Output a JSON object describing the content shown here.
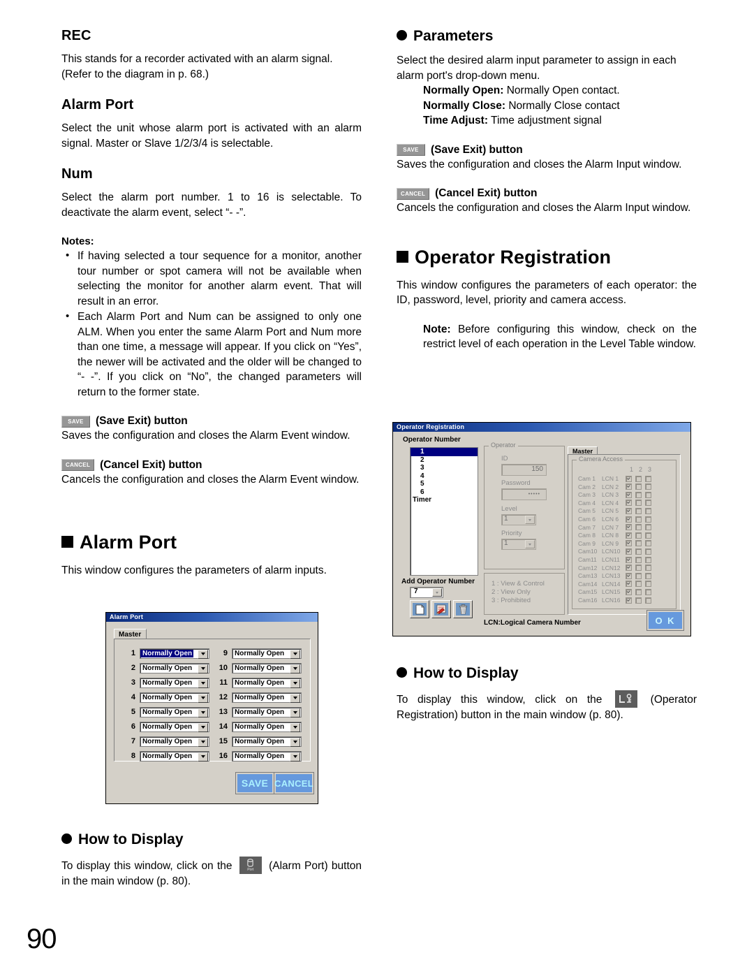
{
  "page_number": "90",
  "left_column": {
    "rec_heading": "REC",
    "rec_body": "This stands for a recorder activated with an alarm signal. (Refer to the diagram in p. 68.)",
    "alarmport_heading": "Alarm Port",
    "alarmport_body": "Select the unit whose alarm port is activated with an alarm signal. Master or Slave 1/2/3/4 is selectable.",
    "num_heading": "Num",
    "num_body": "Select the alarm port number. 1 to 16 is selectable. To deactivate the alarm event, select “- -”.",
    "notes_label": "Notes:",
    "notes": [
      "If having selected a tour sequence for a monitor, another tour number or spot camera will not be available when selecting the monitor for another alarm event. That will result in an error.",
      "Each Alarm Port and Num can be assigned to only one ALM. When you enter the same Alarm Port and Num more than one time, a message will appear. If you click on “Yes”, the newer will be activated and the older will be changed to “- -”. If you click on “No”, the changed parameters will return to the former state."
    ],
    "save_btn_icon": "SAVE",
    "save_btn_label": "(Save Exit) button",
    "save_btn_body": "Saves the configuration and closes the Alarm Event window.",
    "cancel_btn_icon": "CANCEL",
    "cancel_btn_label": "(Cancel Exit) button",
    "cancel_btn_body": "Cancels the configuration and closes the Alarm Event window.",
    "section_alarm_port": "Alarm Port",
    "section_alarm_port_body": "This window configures the parameters of alarm inputs.",
    "howto_heading": "How to Display",
    "howto_before": "To display this window, click on the",
    "howto_icon_label": "Port",
    "howto_after": "(Alarm Port) button in the main window (p. 80)."
  },
  "right_column": {
    "parameters_heading": "Parameters",
    "parameters_body": "Select the desired alarm input parameter to assign in each alarm port's drop-down menu.",
    "param_items": [
      {
        "term": "Normally Open:",
        "desc": "Normally Open contact."
      },
      {
        "term": "Normally Close:",
        "desc": "Normally Close contact"
      },
      {
        "term": "Time Adjust:",
        "desc": "Time adjustment signal"
      }
    ],
    "save_btn_icon": "SAVE",
    "save_btn_label": "(Save Exit) button",
    "save_btn_body": "Saves the configuration and closes the Alarm Input window.",
    "cancel_btn_icon": "CANCEL",
    "cancel_btn_label": "(Cancel Exit) button",
    "cancel_btn_body": "Cancels the configuration and closes the Alarm Input window.",
    "section_operator_registration": "Operator Registration",
    "section_operator_body": "This window configures the parameters of each operator: the ID, password, level, priority and camera access.",
    "note_label": "Note:",
    "note_body": "Before configuring this window, check on the restrict level of each operation in the Level Table window.",
    "howto_heading": "How to Display",
    "howto_before": "To display this window, click on the",
    "howto_after": "(Operator Registration) button in the main window (p. 80)."
  },
  "alarm_port_dialog": {
    "title": "Alarm Port",
    "tab": "Master",
    "ports_left": [
      {
        "num": "1",
        "value": "Normally Open",
        "selected": true
      },
      {
        "num": "2",
        "value": "Normally Open",
        "selected": false
      },
      {
        "num": "3",
        "value": "Normally Open",
        "selected": false
      },
      {
        "num": "4",
        "value": "Normally Open",
        "selected": false
      },
      {
        "num": "5",
        "value": "Normally Open",
        "selected": false
      },
      {
        "num": "6",
        "value": "Normally Open",
        "selected": false
      },
      {
        "num": "7",
        "value": "Normally Open",
        "selected": false
      },
      {
        "num": "8",
        "value": "Normally Open",
        "selected": false
      }
    ],
    "ports_right": [
      {
        "num": "9",
        "value": "Normally Open"
      },
      {
        "num": "10",
        "value": "Normally Open"
      },
      {
        "num": "11",
        "value": "Normally Open"
      },
      {
        "num": "12",
        "value": "Normally Open"
      },
      {
        "num": "13",
        "value": "Normally Open"
      },
      {
        "num": "14",
        "value": "Normally Open"
      },
      {
        "num": "15",
        "value": "Normally Open"
      },
      {
        "num": "16",
        "value": "Normally Open"
      }
    ],
    "save_label": "SAVE",
    "cancel_label": "CANCEL"
  },
  "operator_dialog": {
    "title": "Operator Registration",
    "operator_number_label": "Operator Number",
    "operator_numbers": [
      "1",
      "2",
      "3",
      "4",
      "5",
      "6",
      "Timer"
    ],
    "selected_operator": "1",
    "add_operator_label": "Add Operator Number",
    "add_operator_value": "7",
    "operator_group_legend": "Operator",
    "id_label": "ID",
    "id_value": "150",
    "password_label": "Password",
    "password_value": "•••••",
    "level_label": "Level",
    "level_value": "1",
    "priority_label": "Priority",
    "priority_value": "1",
    "legend_lines": [
      "1 : View & Control",
      "2 : View Only",
      "3 : Prohibited"
    ],
    "camera_tab": "Master",
    "camera_access_legend": "Camera Access",
    "camera_columns": [
      "1",
      "2",
      "3"
    ],
    "camera_rows": [
      {
        "cam": "Cam 1",
        "lcn": "LCN 1",
        "checks": [
          true,
          false,
          false
        ]
      },
      {
        "cam": "Cam 2",
        "lcn": "LCN 2",
        "checks": [
          true,
          false,
          false
        ]
      },
      {
        "cam": "Cam 3",
        "lcn": "LCN 3",
        "checks": [
          true,
          false,
          false
        ]
      },
      {
        "cam": "Cam 4",
        "lcn": "LCN 4",
        "checks": [
          true,
          false,
          false
        ]
      },
      {
        "cam": "Cam 5",
        "lcn": "LCN 5",
        "checks": [
          true,
          false,
          false
        ]
      },
      {
        "cam": "Cam 6",
        "lcn": "LCN 6",
        "checks": [
          true,
          false,
          false
        ]
      },
      {
        "cam": "Cam 7",
        "lcn": "LCN 7",
        "checks": [
          true,
          false,
          false
        ]
      },
      {
        "cam": "Cam 8",
        "lcn": "LCN 8",
        "checks": [
          true,
          false,
          false
        ]
      },
      {
        "cam": "Cam 9",
        "lcn": "LCN 9",
        "checks": [
          true,
          false,
          false
        ]
      },
      {
        "cam": "Cam10",
        "lcn": "LCN10",
        "checks": [
          true,
          false,
          false
        ]
      },
      {
        "cam": "Cam11",
        "lcn": "LCN11",
        "checks": [
          true,
          false,
          false
        ]
      },
      {
        "cam": "Cam12",
        "lcn": "LCN12",
        "checks": [
          true,
          false,
          false
        ]
      },
      {
        "cam": "Cam13",
        "lcn": "LCN13",
        "checks": [
          true,
          false,
          false
        ]
      },
      {
        "cam": "Cam14",
        "lcn": "LCN14",
        "checks": [
          true,
          false,
          false
        ]
      },
      {
        "cam": "Cam15",
        "lcn": "LCN15",
        "checks": [
          true,
          false,
          false
        ]
      },
      {
        "cam": "Cam16",
        "lcn": "LCN16",
        "checks": [
          true,
          false,
          false
        ]
      }
    ],
    "lcn_footnote": "LCN:Logical Camera Number",
    "ok_label": "O K"
  },
  "colors": {
    "dialog_face": "#d4d0c8",
    "titlebar_dark": "#0a2a7a",
    "titlebar_light": "#7fa8e8",
    "button_blue": "#6699dd",
    "button_text": "#aaf0ff",
    "selection_blue": "#000080",
    "inline_button_gray": "#969696"
  }
}
